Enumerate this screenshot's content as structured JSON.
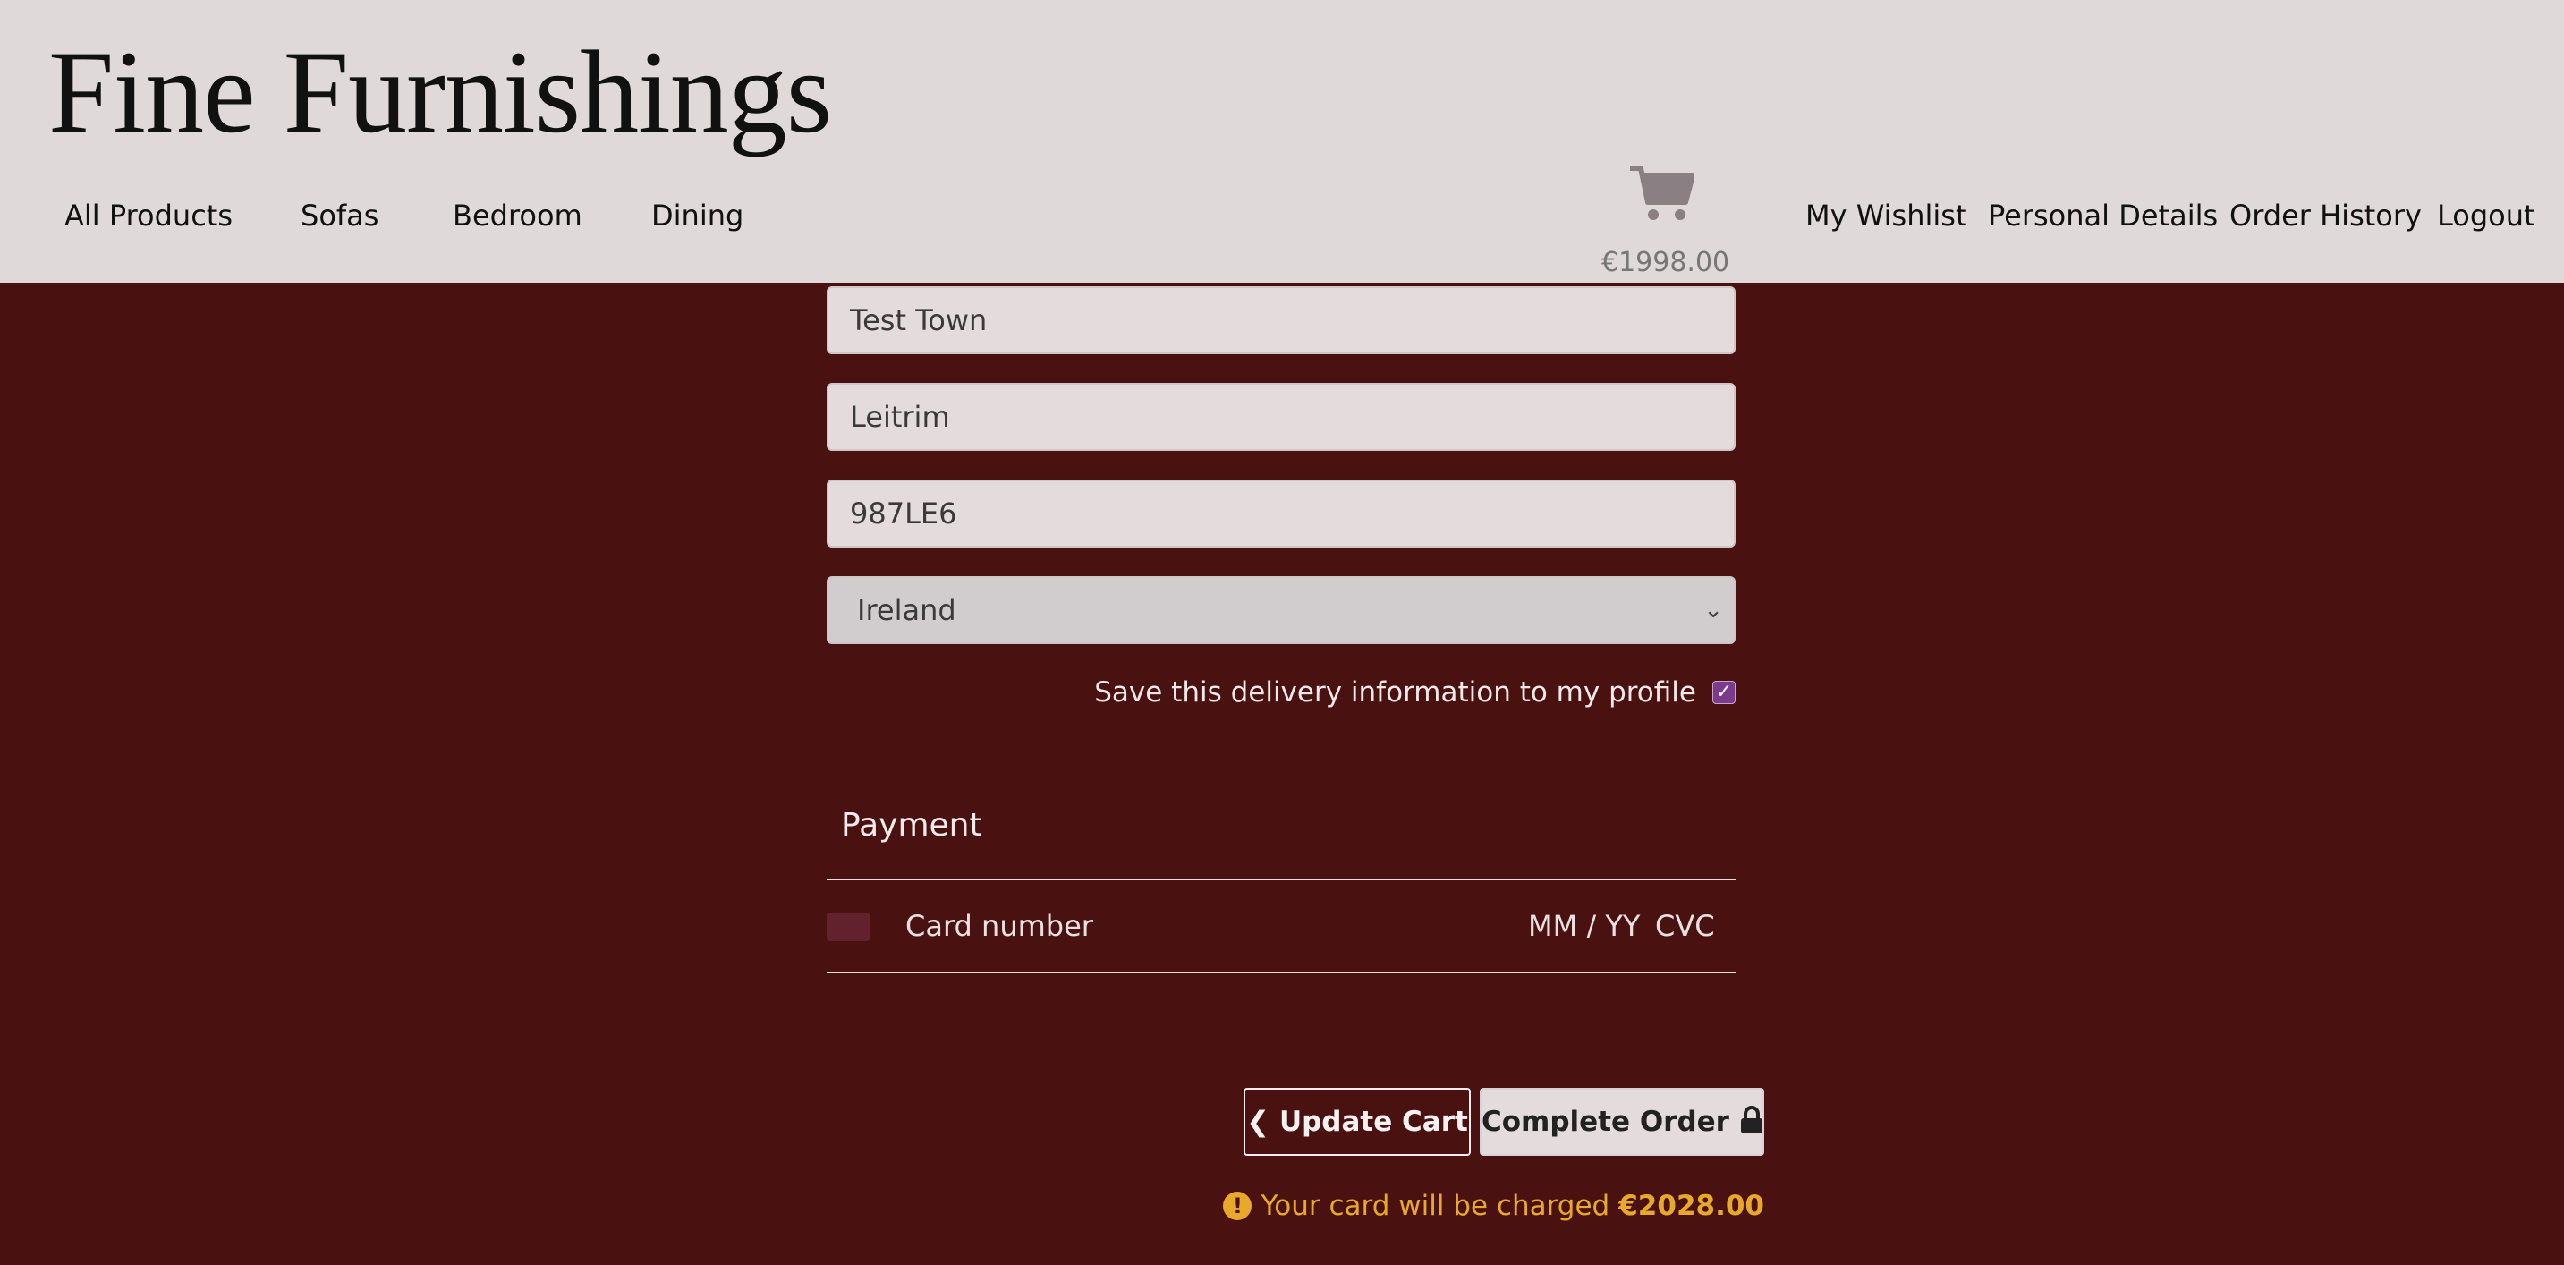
{
  "brand": "Fine Furnishings",
  "nav": {
    "left": [
      "All Products",
      "Sofas",
      "Bedroom",
      "Dining"
    ],
    "right": [
      "My Wishlist",
      "Personal Details",
      "Order History",
      "Logout"
    ]
  },
  "cart": {
    "icon": "shopping-cart-icon",
    "total": "€1998.00"
  },
  "form": {
    "town": "Test Town",
    "county": "Leitrim",
    "postcode": "987LE6",
    "country": "Ireland",
    "save_label": "Save this delivery information to my profile",
    "save_checked": true
  },
  "payment": {
    "title": "Payment",
    "card_number_placeholder": "Card number",
    "expiry_placeholder": "MM / YY",
    "cvc_placeholder": "CVC"
  },
  "buttons": {
    "update_cart": "Update Cart",
    "complete_order": "Complete Order"
  },
  "charge": {
    "prefix": "Your card will be charged",
    "amount": "€2028.00"
  },
  "colors": {
    "header_bg": "#e0d9d9",
    "page_bg": "#4a1111",
    "warning": "#e8a92a",
    "checkbox": "#7b3a8b"
  }
}
